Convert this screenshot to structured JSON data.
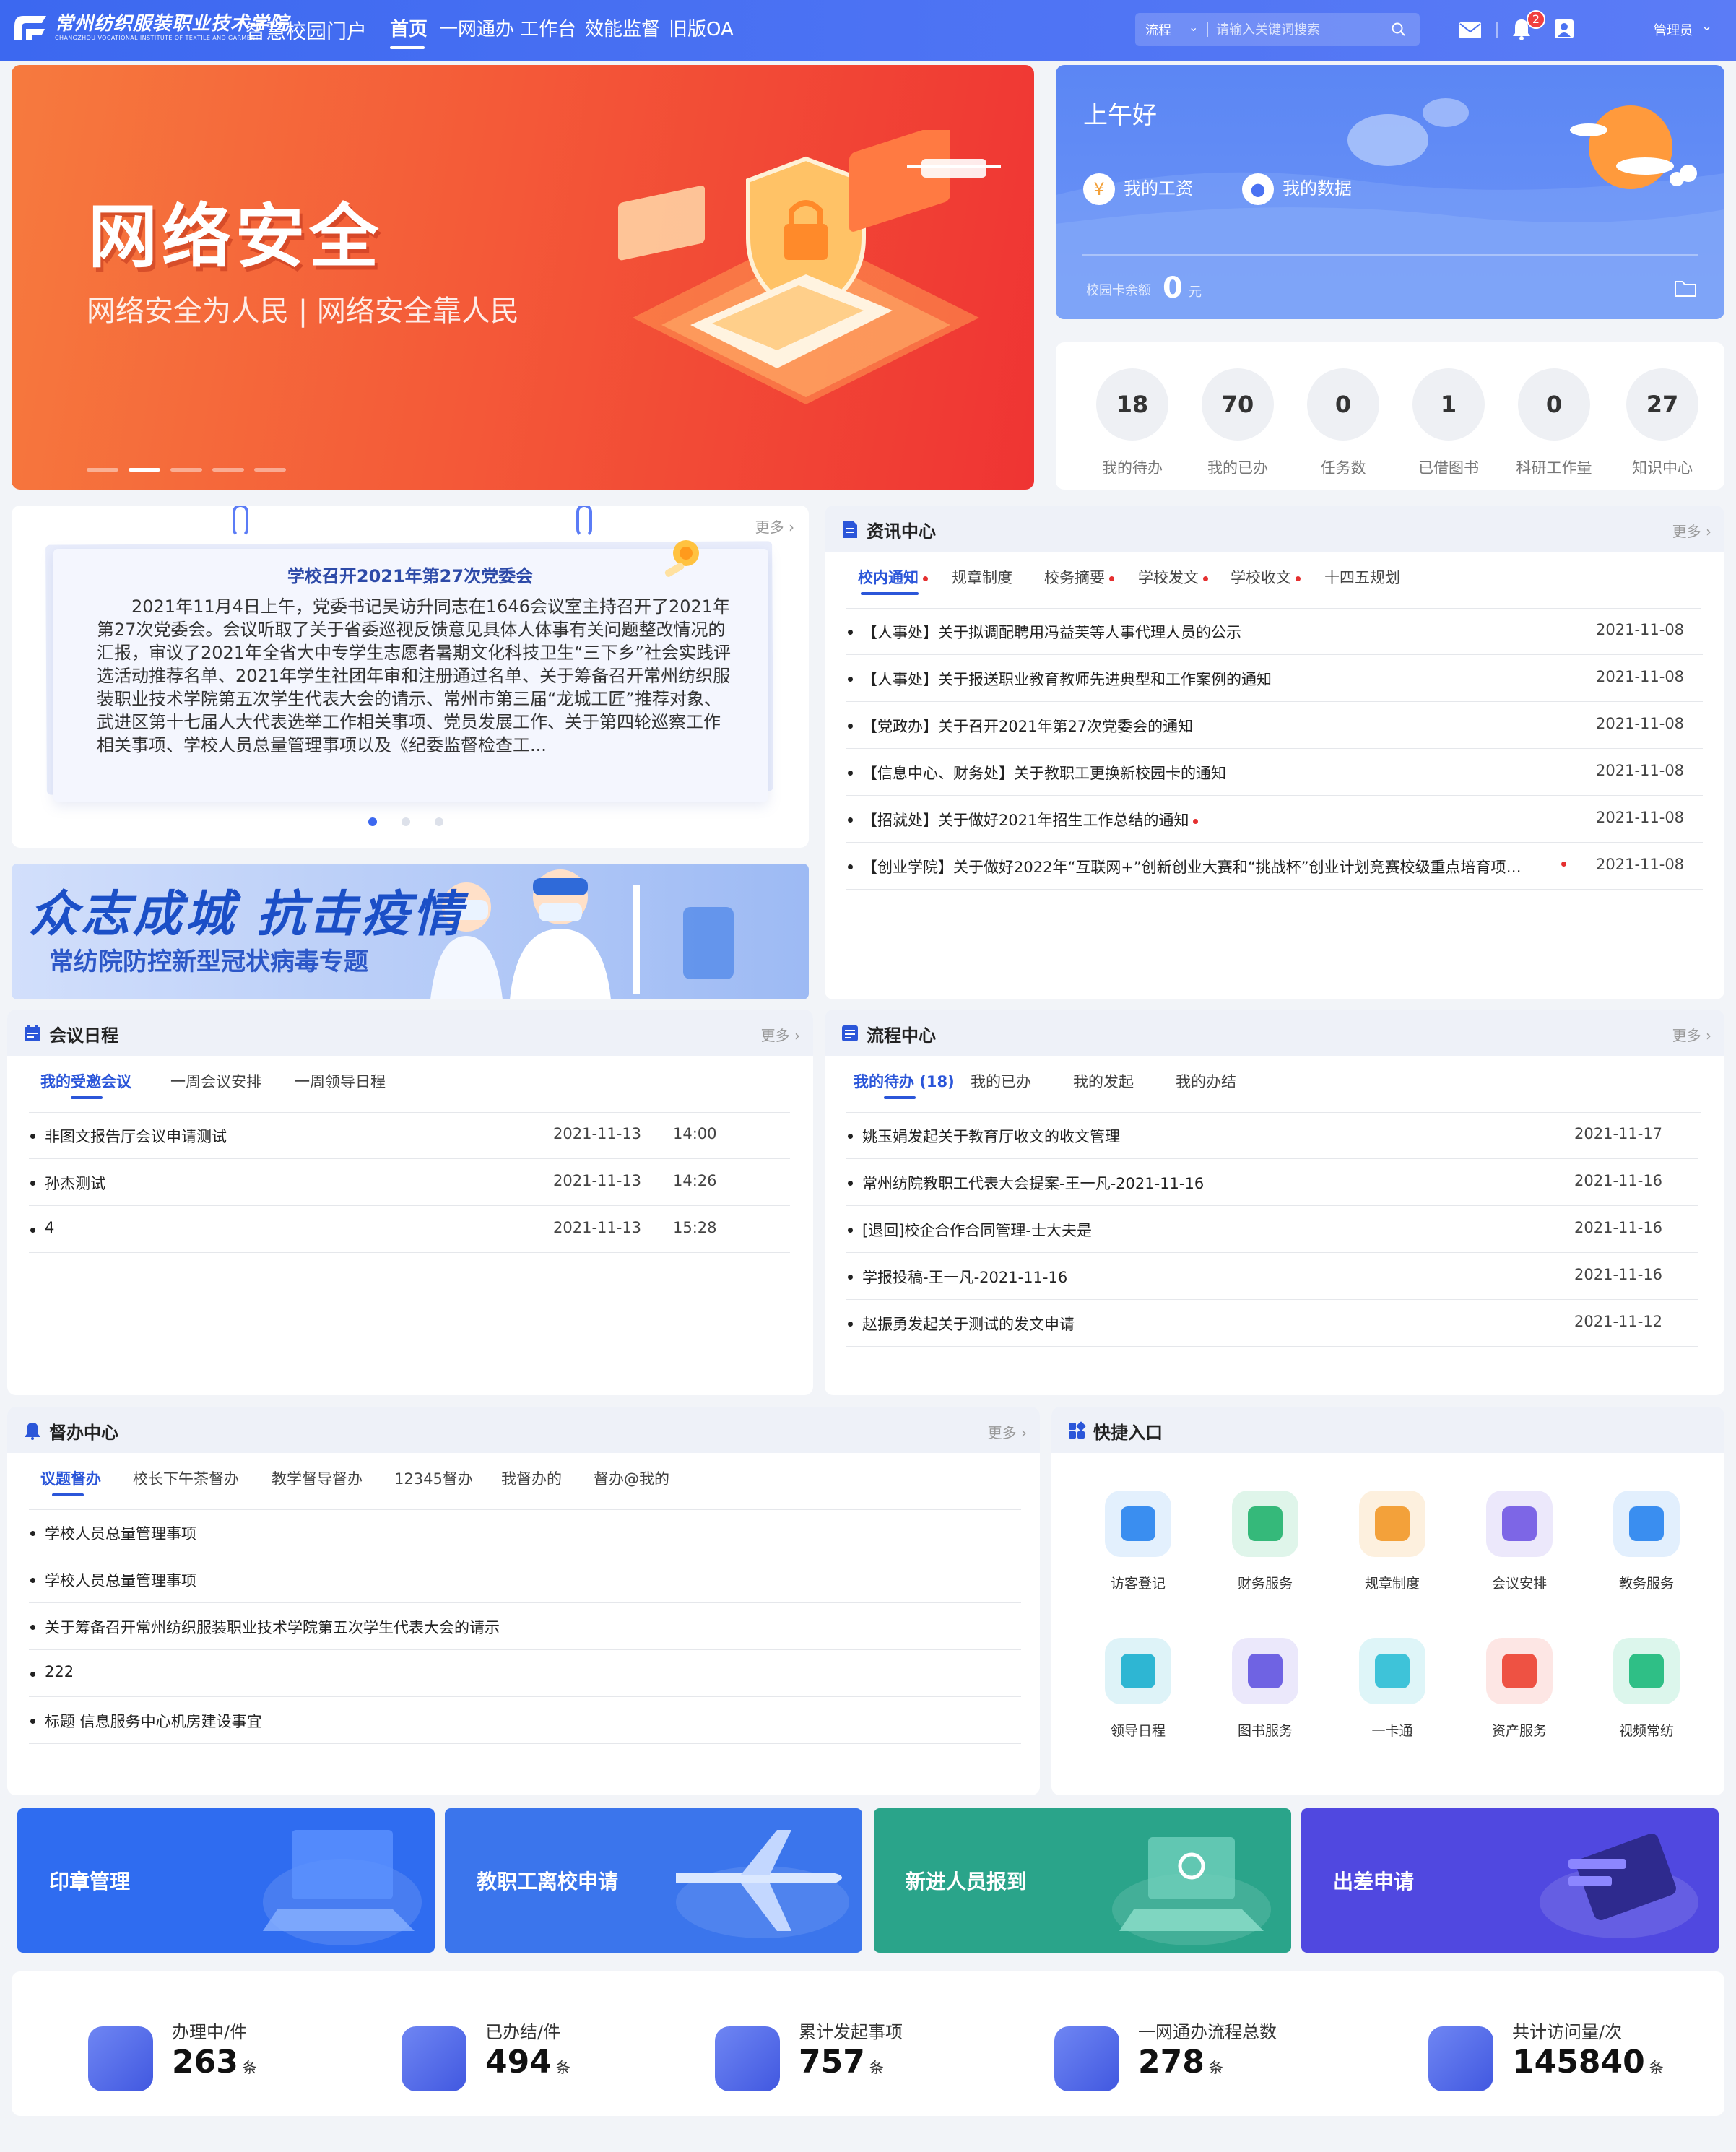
{
  "header": {
    "logo_cn": "常州纺织服装职业技术学院",
    "logo_en": "CHANGZHOU VOCATIONAL INSTITUTE OF TEXTILE AND GARMENT",
    "portal_title": "智慧校园门户",
    "nav": [
      "首页",
      "一网通办",
      "工作台",
      "效能监督",
      "旧版OA"
    ],
    "search_type": "流程",
    "search_placeholder": "请输入关键词搜索",
    "notification_count": "2",
    "user": "管理员"
  },
  "banner": {
    "title": "网络安全",
    "subtitle": "网络安全为人民 | 网络安全靠人民",
    "slides": 5,
    "active_slide": 2
  },
  "greeting": {
    "hello": "上午好",
    "salary": "我的工资",
    "my_data": "我的数据",
    "card_balance_label": "校园卡余额",
    "card_balance_value": "0",
    "card_balance_unit": "元"
  },
  "stats": [
    {
      "value": "18",
      "label": "我的待办"
    },
    {
      "value": "70",
      "label": "我的已办"
    },
    {
      "value": "0",
      "label": "任务数"
    },
    {
      "value": "1",
      "label": "已借图书"
    },
    {
      "value": "0",
      "label": "科研工作量"
    },
    {
      "value": "27",
      "label": "知识中心"
    }
  ],
  "notice": {
    "more": "更多",
    "title": "学校召开2021年第27次党委会",
    "body": "2021年11月4日上午，党委书记吴访升同志在1646会议室主持召开了2021年第27次党委会。会议听取了关于省委巡视反馈意见具体人体事有关问题整改情况的汇报，审议了2021年全省大中专学生志愿者暑期文化科技卫生“三下乡”社会实践评选活动推荐名单、2021年学生社团年审和注册通过名单、关于筹备召开常州纺织服装职业技术学院第五次学生代表大会的请示、常州市第三届“龙城工匠”推荐对象、武进区第十七届人大代表选举工作相关事项、党员发展工作、关于第四轮巡察工作相关事项、学校人员总量管理事项以及《纪委监督检查工..."
  },
  "epidemic": {
    "title": "众志成城 抗击疫情",
    "subtitle": "常纺院防控新型冠状病毒专题"
  },
  "news": {
    "title": "资讯中心",
    "more": "更多",
    "tabs": [
      "校内通知",
      "规章制度",
      "校务摘要",
      "学校发文",
      "学校收文",
      "十四五规划"
    ],
    "items": [
      {
        "title": "【人事处】关于拟调配聘用冯益芙等人事代理人员的公示",
        "date": "2021-11-08"
      },
      {
        "title": "【人事处】关于报送职业教育教师先进典型和工作案例的通知",
        "date": "2021-11-08"
      },
      {
        "title": "【党政办】关于召开2021年第27次党委会的通知",
        "date": "2021-11-08"
      },
      {
        "title": "【信息中心、财务处】关于教职工更换新校园卡的通知",
        "date": "2021-11-08"
      },
      {
        "title": "【招就处】关于做好2021年招生工作总结的通知",
        "date": "2021-11-08"
      },
      {
        "title": "【创业学院】关于做好2022年“互联网+”创新创业大赛和“挑战杯”创业计划竞赛校级重点培育项目...",
        "date": "2021-11-08"
      }
    ]
  },
  "meetings": {
    "title": "会议日程",
    "more": "更多",
    "tabs": [
      "我的受邀会议",
      "一周会议安排",
      "一周领导日程"
    ],
    "items": [
      {
        "title": "非图文报告厅会议申请测试",
        "date": "2021-11-13",
        "time": "14:00"
      },
      {
        "title": "孙杰测试",
        "date": "2021-11-13",
        "time": "14:26"
      },
      {
        "title": "4",
        "date": "2021-11-13",
        "time": "15:28"
      }
    ]
  },
  "process": {
    "title": "流程中心",
    "more": "更多",
    "tabs": [
      "我的待办 (18)",
      "我的已办",
      "我的发起",
      "我的办结"
    ],
    "items": [
      {
        "title": "姚玉娟发起关于教育厅收文的收文管理",
        "date": "2021-11-17"
      },
      {
        "title": "常州纺院教职工代表大会提案-王一凡-2021-11-16",
        "date": "2021-11-16"
      },
      {
        "title": "[退回]校企合作合同管理-士大夫是",
        "date": "2021-11-16"
      },
      {
        "title": "学报投稿-王一凡-2021-11-16",
        "date": "2021-11-16"
      },
      {
        "title": "赵振勇发起关于测试的发文申请",
        "date": "2021-11-12"
      }
    ]
  },
  "supervise": {
    "title": "督办中心",
    "more": "更多",
    "tabs": [
      "议题督办",
      "校长下午茶督办",
      "教学督导督办",
      "12345督办",
      "我督办的",
      "督办@我的"
    ],
    "items": [
      "学校人员总量管理事项",
      "学校人员总量管理事项",
      "关于筹备召开常州纺织服装职业技术学院第五次学生代表大会的请示",
      "222",
      "标题 信息服务中心机房建设事宜"
    ]
  },
  "quick": {
    "title": "快捷入口",
    "items": [
      {
        "label": "访客登记",
        "bg": "#e3f0fd",
        "fg": "#3a8ef0"
      },
      {
        "label": "财务服务",
        "bg": "#dff5ea",
        "fg": "#35b97a"
      },
      {
        "label": "规章制度",
        "bg": "#fdf0de",
        "fg": "#f3a13a"
      },
      {
        "label": "会议安排",
        "bg": "#ece8fb",
        "fg": "#7d66e6"
      },
      {
        "label": "教务服务",
        "bg": "#e2effd",
        "fg": "#3a8ef0"
      },
      {
        "label": "领导日程",
        "bg": "#def3f8",
        "fg": "#2eb6d3"
      },
      {
        "label": "图书服务",
        "bg": "#ebe8fb",
        "fg": "#6f63e3"
      },
      {
        "label": "一卡通",
        "bg": "#def5f8",
        "fg": "#3ec3d9"
      },
      {
        "label": "资产服务",
        "bg": "#fde6e4",
        "fg": "#ee5243"
      },
      {
        "label": "视频常纺",
        "bg": "#dcf6ec",
        "fg": "#2fbf86"
      }
    ]
  },
  "tiles": [
    {
      "label": "印章管理",
      "color": "#2f6cf0"
    },
    {
      "label": "教职工离校申请",
      "color": "#3b75ec"
    },
    {
      "label": "新进人员报到",
      "color": "#2aa48a"
    },
    {
      "label": "出差申请",
      "color": "#5048e0"
    }
  ],
  "bottom_stats": [
    {
      "label": "办理中/件",
      "value": "263",
      "unit": "条"
    },
    {
      "label": "已办结/件",
      "value": "494",
      "unit": "条"
    },
    {
      "label": "累计发起事项",
      "value": "757",
      "unit": "条"
    },
    {
      "label": "一网通办流程总数",
      "value": "278",
      "unit": "条"
    },
    {
      "label": "共计访问量/次",
      "value": "145840",
      "unit": "条"
    }
  ]
}
